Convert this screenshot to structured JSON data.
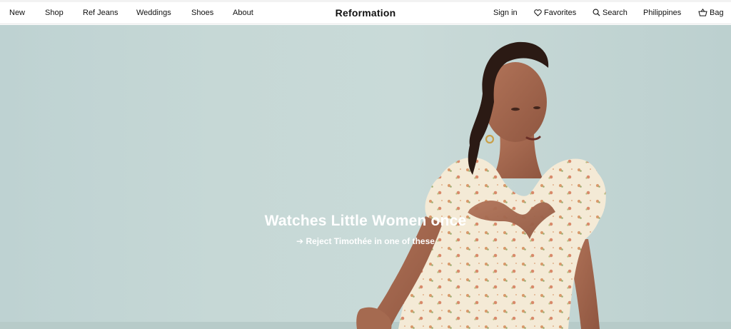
{
  "nav": {
    "left": [
      "New",
      "Shop",
      "Ref Jeans",
      "Weddings",
      "Shoes",
      "About"
    ],
    "brand": "Reformation",
    "sign_in": "Sign in",
    "favorites": "Favorites",
    "search": "Search",
    "region": "Philippines",
    "bag": "Bag"
  },
  "hero": {
    "headline": "Watches Little Women once",
    "cta_arrow": "➔",
    "cta": "Reject Timothée in one of these"
  },
  "colors": {
    "background": "#c6d8d6",
    "text": "#111111",
    "hero_text": "#ffffff"
  }
}
